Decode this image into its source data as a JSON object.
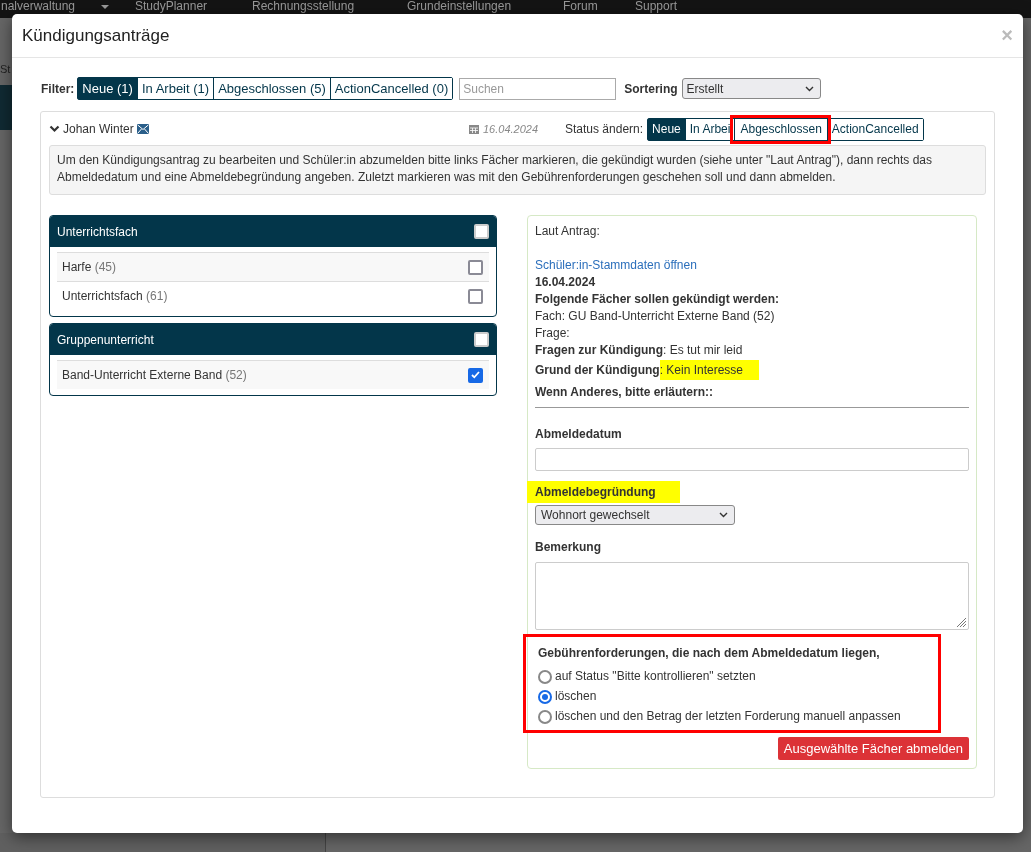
{
  "background": {
    "nav_items": [
      "nalverwaltung",
      "StudyPlanner",
      "Rechnungsstellung",
      "Grundeinstellungen",
      "Forum",
      "Support"
    ],
    "side_text": "St"
  },
  "dialog": {
    "title": "Kündigungsanträge",
    "close": "×"
  },
  "filter": {
    "label": "Filter:",
    "tabs": [
      {
        "label": "Neue (1)",
        "selected": true
      },
      {
        "label": "In Arbeit (1)",
        "selected": false
      },
      {
        "label": "Abgeschlossen (5)",
        "selected": false
      },
      {
        "label": "ActionCancelled (0)",
        "selected": false
      }
    ],
    "search": {
      "placeholder": "Suchen"
    },
    "sort": {
      "label": "Sortering",
      "value": "Erstellt"
    }
  },
  "request": {
    "expanded": true,
    "name": "Johan Winter",
    "date": "16.04.2024",
    "status_label": "Status ändern:",
    "status_buttons": [
      {
        "label": "Neue",
        "selected": true,
        "annotated": false
      },
      {
        "label": "In Arbei",
        "selected": false,
        "annotated": false
      },
      {
        "label": "Abgeschlossen",
        "selected": false,
        "annotated": true
      },
      {
        "label": "ActionCancelled",
        "selected": false,
        "annotated": false
      }
    ],
    "hint": "Um den Kündigungsantrag zu bearbeiten und Schüler:in abzumelden bitte links Fächer markieren, die gekündigt wurden (siehe unter \"Laut Antrag\"), dann rechts das Abmeldedatum und eine Abmeldebegründung angeben. Zuletzt markieren was mit den Gebührenforderungen geschehen soll und dann abmelden.",
    "subject_groups": [
      {
        "title": "Unterrichtsfach",
        "checked": false,
        "items": [
          {
            "name": "Harfe",
            "count": "(45)",
            "checked": false
          },
          {
            "name": "Unterrichtsfach",
            "count": "(61)",
            "checked": false
          }
        ]
      },
      {
        "title": "Gruppenunterricht",
        "checked": false,
        "items": [
          {
            "name": "Band-Unterricht Externe Band",
            "count": "(52)",
            "checked": true
          }
        ]
      }
    ],
    "details": {
      "according_label": "Laut Antrag:",
      "link": "Schüler:in-Stammdaten öffnen",
      "date": "16.04.2024",
      "lines": [
        {
          "kind": "heading",
          "text": "Folgende Fächer sollen gekündigt werden:"
        },
        {
          "kind": "plain",
          "text": "Fach: GU Band-Unterricht Externe Band (52)"
        },
        {
          "kind": "plain",
          "text": "Frage:"
        },
        {
          "kind": "pair",
          "label": "Fragen zur Kündigung",
          "value": ": Es tut mir leid",
          "highlighted": false
        },
        {
          "kind": "pair",
          "label": "Grund der Kündigung",
          "value": ": Kein Interesse",
          "highlighted": true
        },
        {
          "kind": "heading",
          "text": "Wenn Anderes, bitte erläutern::"
        }
      ],
      "date_field": {
        "label": "Abmeldedatum"
      },
      "reason": {
        "label": "Abmeldebegründung",
        "highlighted": true,
        "value": "Wohnort gewechselt"
      },
      "remark": {
        "label": "Bemerkung"
      },
      "fees": {
        "heading": "Gebührenforderungen, die nach dem Abmeldedatum liegen,",
        "annotated": true,
        "options": [
          {
            "label": "auf Status \"Bitte kontrollieren\" setzten",
            "selected": false
          },
          {
            "label": "löschen",
            "selected": true
          },
          {
            "label": "löschen und den Betrag der letzten Forderung manuell anpassen",
            "selected": false
          }
        ]
      },
      "submit": "Ausgewählte Fächer abmelden"
    }
  }
}
